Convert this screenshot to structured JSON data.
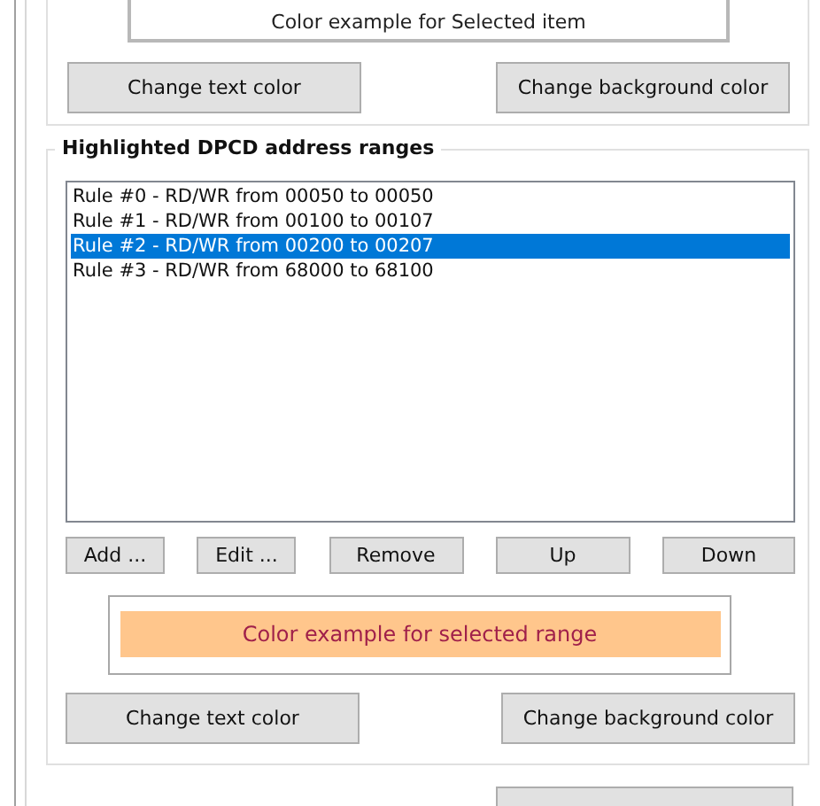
{
  "item_color_group": {
    "example_text": "Color example for Selected item",
    "buttons": [
      "Change text color",
      "Change background color"
    ]
  },
  "ranges_group": {
    "title": "Highlighted DPCD address ranges",
    "rules": [
      {
        "label": "Rule #0 - RD/WR from 00050 to 00050",
        "selected": false
      },
      {
        "label": "Rule #1 - RD/WR from 00100 to 00107",
        "selected": false
      },
      {
        "label": "Rule #2 - RD/WR from 00200 to 00207",
        "selected": true
      },
      {
        "label": "Rule #3 - RD/WR from 68000 to 68100",
        "selected": false
      }
    ],
    "list_buttons": [
      "Add ...",
      "Edit ...",
      "Remove",
      "Up",
      "Down"
    ],
    "example_text": "Color example for selected range",
    "buttons": [
      "Change text color",
      "Change background color"
    ]
  }
}
